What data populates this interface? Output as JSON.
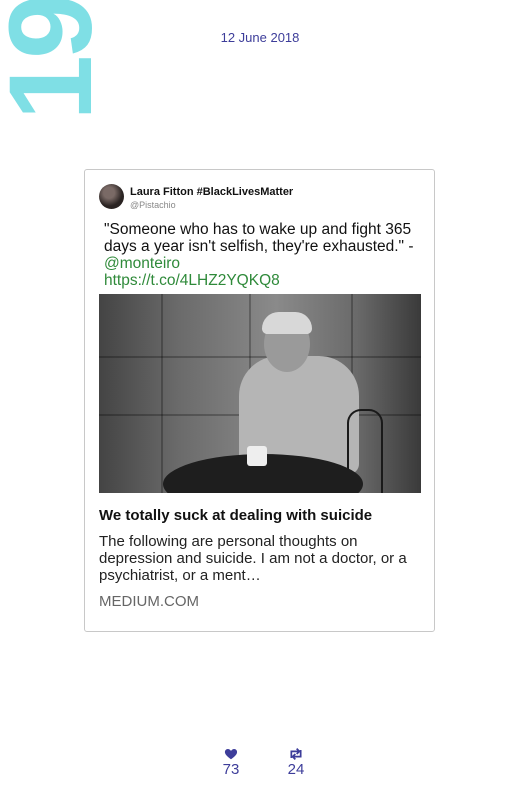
{
  "big_number": "19",
  "date": "12 June 2018",
  "tweet": {
    "author_name": "Laura Fitton #BlackLivesMatter",
    "author_handle": "@Pistachio",
    "text_prefix": "\"Someone who has to wake up and fight 365 days a year isn't selfish, they're exhausted.\" -",
    "mention": "@monteiro",
    "link": "https://t.co/4LHZ2YQKQ8"
  },
  "link_card": {
    "title": "We totally suck at dealing with suicide",
    "description": "The following are personal thoughts on depression and suicide. I am not a doctor, or a psychiatrist, or a ment…",
    "domain": "MEDIUM.COM"
  },
  "stats": {
    "likes": "73",
    "retweets": "24"
  },
  "colors": {
    "big_number": "#7fdfe5",
    "date_text": "#3d3d9a",
    "link_green": "#2f8a3a"
  },
  "icons": {
    "likes": "heart-icon",
    "retweets": "retweet-icon"
  }
}
